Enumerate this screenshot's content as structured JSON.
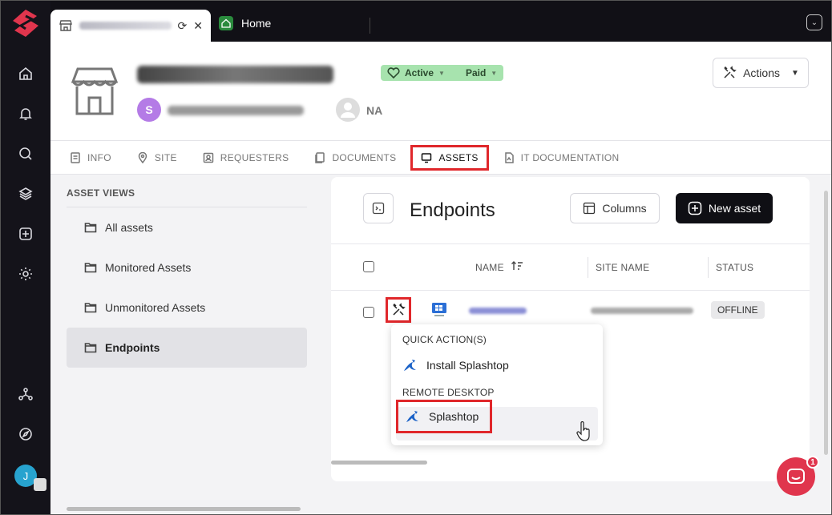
{
  "tabbar": {
    "active_tab_title": "",
    "home_tab_label": "Home"
  },
  "header": {
    "status_badge": "Active",
    "billing_badge": "Paid",
    "owner_initial": "S",
    "assignee": "NA",
    "actions_label": "Actions"
  },
  "tabs": [
    {
      "label": "INFO"
    },
    {
      "label": "SITE"
    },
    {
      "label": "REQUESTERS"
    },
    {
      "label": "DOCUMENTS"
    },
    {
      "label": "ASSETS"
    },
    {
      "label": "IT DOCUMENTATION"
    }
  ],
  "asset_views": {
    "heading": "ASSET VIEWS",
    "items": [
      {
        "label": "All assets"
      },
      {
        "label": "Monitored Assets"
      },
      {
        "label": "Unmonitored Assets"
      },
      {
        "label": "Endpoints"
      }
    ]
  },
  "card": {
    "title": "Endpoints",
    "columns_label": "Columns",
    "new_asset_label": "New asset",
    "columns": [
      "NAME",
      "SITE NAME",
      "STATUS"
    ],
    "rows": [
      {
        "status": "OFFLINE"
      }
    ]
  },
  "menu": {
    "quick_heading": "QUICK ACTION(S)",
    "install_label": "Install Splashtop",
    "remote_heading": "REMOTE DESKTOP",
    "remote_label": "Splashtop"
  },
  "user": {
    "initial": "J"
  },
  "chat": {
    "badge": "1"
  },
  "colors": {
    "accent_red": "#e0272b",
    "brand": "#e0354d",
    "active_badge": "#a7e3ae"
  }
}
